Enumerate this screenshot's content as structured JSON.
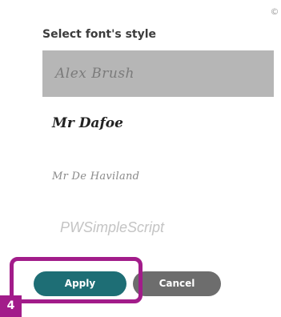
{
  "dialog": {
    "title": "Select font's style",
    "close_icon": "close-icon",
    "fonts": [
      {
        "label": "Alex Brush",
        "selected": true
      },
      {
        "label": "Mr Dafoe",
        "selected": false
      },
      {
        "label": "Mr De Haviland",
        "selected": false
      },
      {
        "label": "PWSimpleScript",
        "selected": false
      }
    ],
    "apply_label": "Apply",
    "cancel_label": "Cancel"
  },
  "annotation": {
    "step_number": "4",
    "highlight_color": "#a21c8a"
  },
  "colors": {
    "apply": "#1e6e75",
    "cancel": "#6d6d6d",
    "selected_row": "#b6b6b6"
  }
}
